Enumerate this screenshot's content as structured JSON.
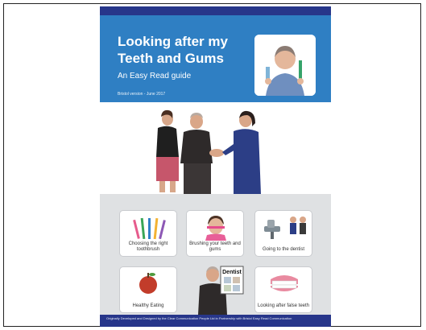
{
  "cover": {
    "title_line1": "Looking after my",
    "title_line2": "Teeth and Gums",
    "subtitle": "An Easy Read guide",
    "version": "Bristol version - June 2017",
    "cards": [
      {
        "label": "Choosing the right toothbrush",
        "icon": "toothbrush-icon"
      },
      {
        "label": "Brushing your teeth and gums",
        "icon": "brushing-icon"
      },
      {
        "label": "Going to the dentist",
        "icon": "dentist-chair-icon"
      },
      {
        "label": "Healthy Eating",
        "icon": "apple-icon"
      },
      {
        "label": "Looking after false teeth",
        "icon": "false-teeth-icon"
      }
    ],
    "sign_text": "Dentist",
    "footer": "Originally Developed and Designed by the Clear Communication People Ltd in Partnership with Bristol Easy Read Communication",
    "colors": {
      "header_blue": "#2f7fc3",
      "dark_band": "#27368a",
      "panel_grey": "#dfe1e3"
    }
  }
}
